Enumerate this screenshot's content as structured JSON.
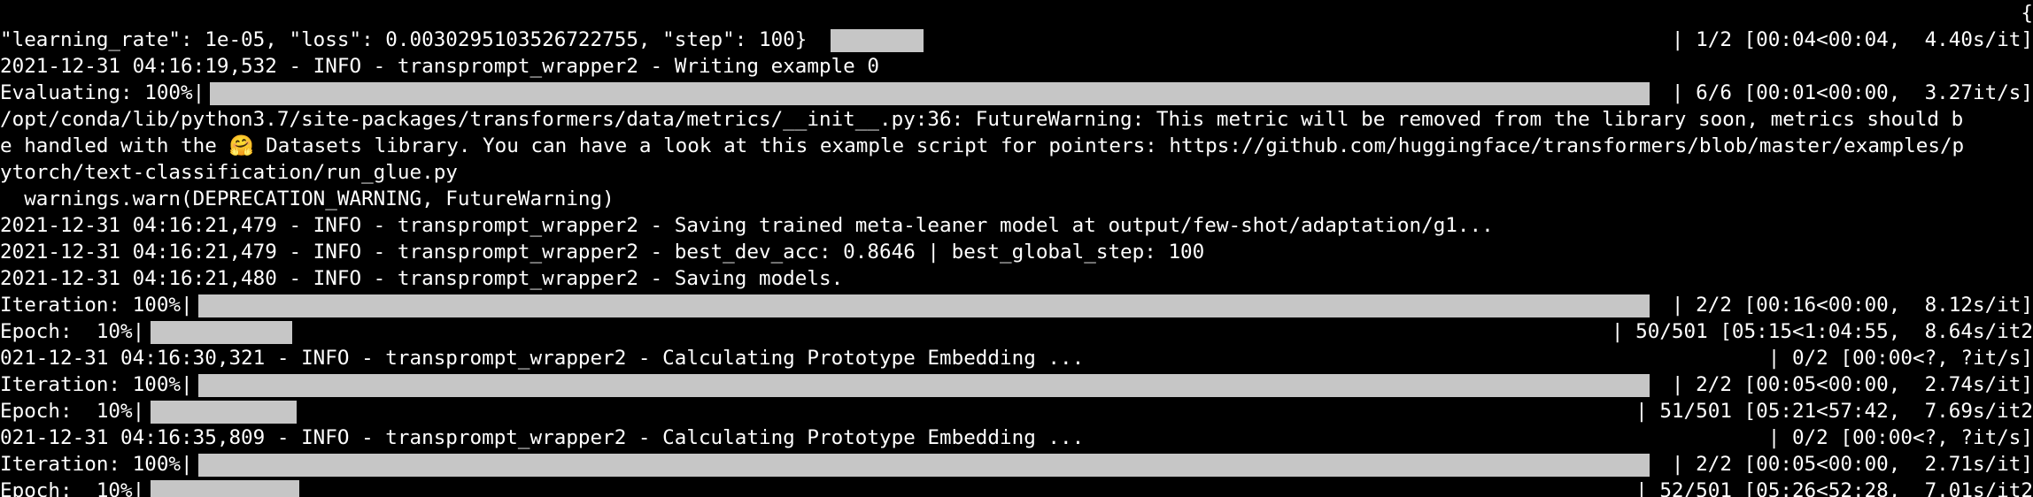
{
  "terminal": {
    "top_char": "{",
    "line1_text": "\"learning_rate\": 1e-05, \"loss\": 0.0030295103526722755, \"step\": 100}",
    "line1_right": "| 1/2 [00:04<00:04,  4.40s/it]",
    "line2_text": "2021-12-31 04:16:19,532 - INFO - transprompt_wrapper2 - Writing example 0",
    "line3_text": "Evaluating: 100%|",
    "line3_right": "| 6/6 [00:01<00:00,  3.27it/s]",
    "line4_text": "/opt/conda/lib/python3.7/site-packages/transformers/data/metrics/__init__.py:36: FutureWarning: This metric will be removed from the library soon, metrics should b",
    "line5_text": "e handled with the 🤗 Datasets library. You can have a look at this example script for pointers: https://github.com/huggingface/transformers/blob/master/examples/p",
    "line6_text": "ytorch/text-classification/run_glue.py",
    "line7_text": "  warnings.warn(DEPRECATION_WARNING, FutureWarning)",
    "line8_text": "2021-12-31 04:16:21,479 - INFO - transprompt_wrapper2 - Saving trained meta-leaner model at output/few-shot/adaptation/g1...",
    "line9_text": "2021-12-31 04:16:21,479 - INFO - transprompt_wrapper2 - best_dev_acc: 0.8646 | best_global_step: 100",
    "line10_text": "2021-12-31 04:16:21,480 - INFO - transprompt_wrapper2 - Saving models.",
    "line11_text": "Iteration: 100%|",
    "line11_right": "| 2/2 [00:16<00:00,  8.12s/it]",
    "line12_text": "Epoch:  10%|",
    "line12_right": "| 50/501 [05:15<1:04:55,  8.64s/it2",
    "line13_text": "021-12-31 04:16:30,321 - INFO - transprompt_wrapper2 - Calculating Prototype Embedding ...",
    "line13_right": "| 0/2 [00:00<?, ?it/s]",
    "line14_text": "Iteration: 100%|",
    "line14_right": "| 2/2 [00:05<00:00,  2.74s/it]",
    "line15_text": "Epoch:  10%|",
    "line15_right": "| 51/501 [05:21<57:42,  7.69s/it2",
    "line16_text": "021-12-31 04:16:35,809 - INFO - transprompt_wrapper2 - Calculating Prototype Embedding ...",
    "line16_right": "| 0/2 [00:00<?, ?it/s]",
    "line17_text": "Iteration: 100%|",
    "line17_right": "| 2/2 [00:05<00:00,  2.71s/it]",
    "line18_text": "Epoch:  10%|",
    "line18_right": "| 52/501 [05:26<52:28,  7.01s/it2"
  },
  "progress": {
    "line1_iter_fraction": 0.5,
    "evaluating_fraction": 1.0,
    "iteration_fraction": 1.0,
    "epoch50_fraction": 0.0998,
    "epoch51_fraction": 0.1018,
    "epoch52_fraction": 0.1038
  },
  "colors": {
    "background": "#000000",
    "text": "#ffffff",
    "progress_fill": "#c6c6c6"
  }
}
